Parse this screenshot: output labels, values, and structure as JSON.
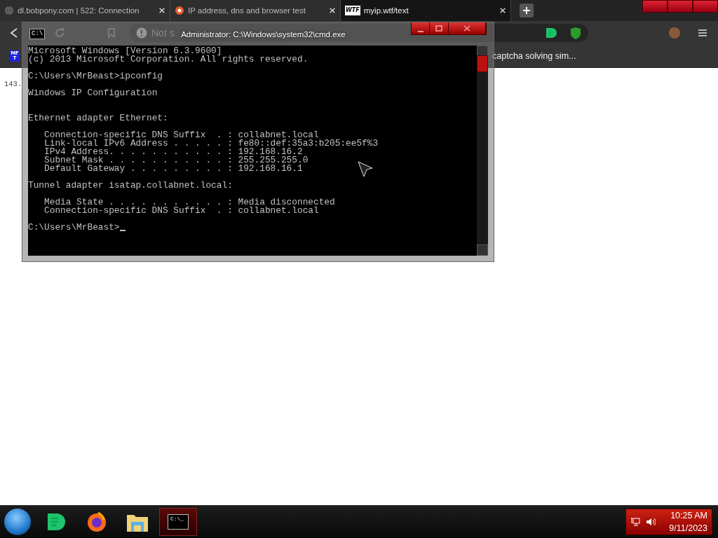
{
  "browser": {
    "tabs": [
      {
        "title": "dl.bobpony.com | 522: Connection",
        "selected": false,
        "kind": "globe"
      },
      {
        "title": "IP address, dns and browser test",
        "selected": false,
        "kind": "site"
      },
      {
        "title": "myip.wtf/text",
        "selected": true,
        "kind": "wtf"
      }
    ],
    "wtf_favicon_text": "WTF",
    "address_bar": {
      "security_text": "Not s"
    },
    "bookmarks": [
      {
        "label": "MF T",
        "kind": "badge"
      },
      {
        "label": "captcha solving sim...",
        "kind": "link"
      }
    ],
    "page_text": "143."
  },
  "cmd_window": {
    "title": "Administrator: C:\\Windows\\system32\\cmd.exe",
    "icon_text": "C:\\",
    "blocks": [
      {
        "kind": "plain",
        "lines": [
          "Microsoft Windows [Version 6.3.9600]",
          "(c) 2013 Microsoft Corporation. All rights reserved."
        ]
      },
      {
        "kind": "plain",
        "lines": [
          "C:\\Users\\MrBeast>ipconfig"
        ]
      },
      {
        "kind": "title",
        "lines": [
          "Windows IP Configuration"
        ]
      },
      {
        "kind": "plain",
        "lines": [
          "Ethernet adapter Ethernet:"
        ]
      },
      {
        "kind": "indented",
        "lines": [
          "Connection-specific DNS Suffix  . : collabnet.local",
          "Link-local IPv6 Address . . . . . : fe80::def:35a3:b205:ee5f%3",
          "IPv4 Address. . . . . . . . . . . : 192.168.16.2",
          "Subnet Mask . . . . . . . . . . . : 255.255.255.0",
          "Default Gateway . . . . . . . . . : 192.168.16.1"
        ]
      },
      {
        "kind": "plain",
        "lines": [
          "Tunnel adapter isatap.collabnet.local:"
        ]
      },
      {
        "kind": "indented",
        "lines": [
          "Media State . . . . . . . . . . . : Media disconnected",
          "Connection-specific DNS Suffix  . : collabnet.local"
        ]
      },
      {
        "kind": "prompt",
        "lines": [
          "C:\\Users\\MrBeast>"
        ]
      }
    ]
  },
  "taskbar": {
    "items": [
      {
        "kind": "chat",
        "active": false
      },
      {
        "kind": "firefox",
        "active": false
      },
      {
        "kind": "folder",
        "active": false
      },
      {
        "kind": "terminal",
        "active": true
      }
    ],
    "terminal_icon_text": "C:\\_",
    "clock": {
      "time": "10:25 AM",
      "date": "9/11/2023"
    }
  }
}
